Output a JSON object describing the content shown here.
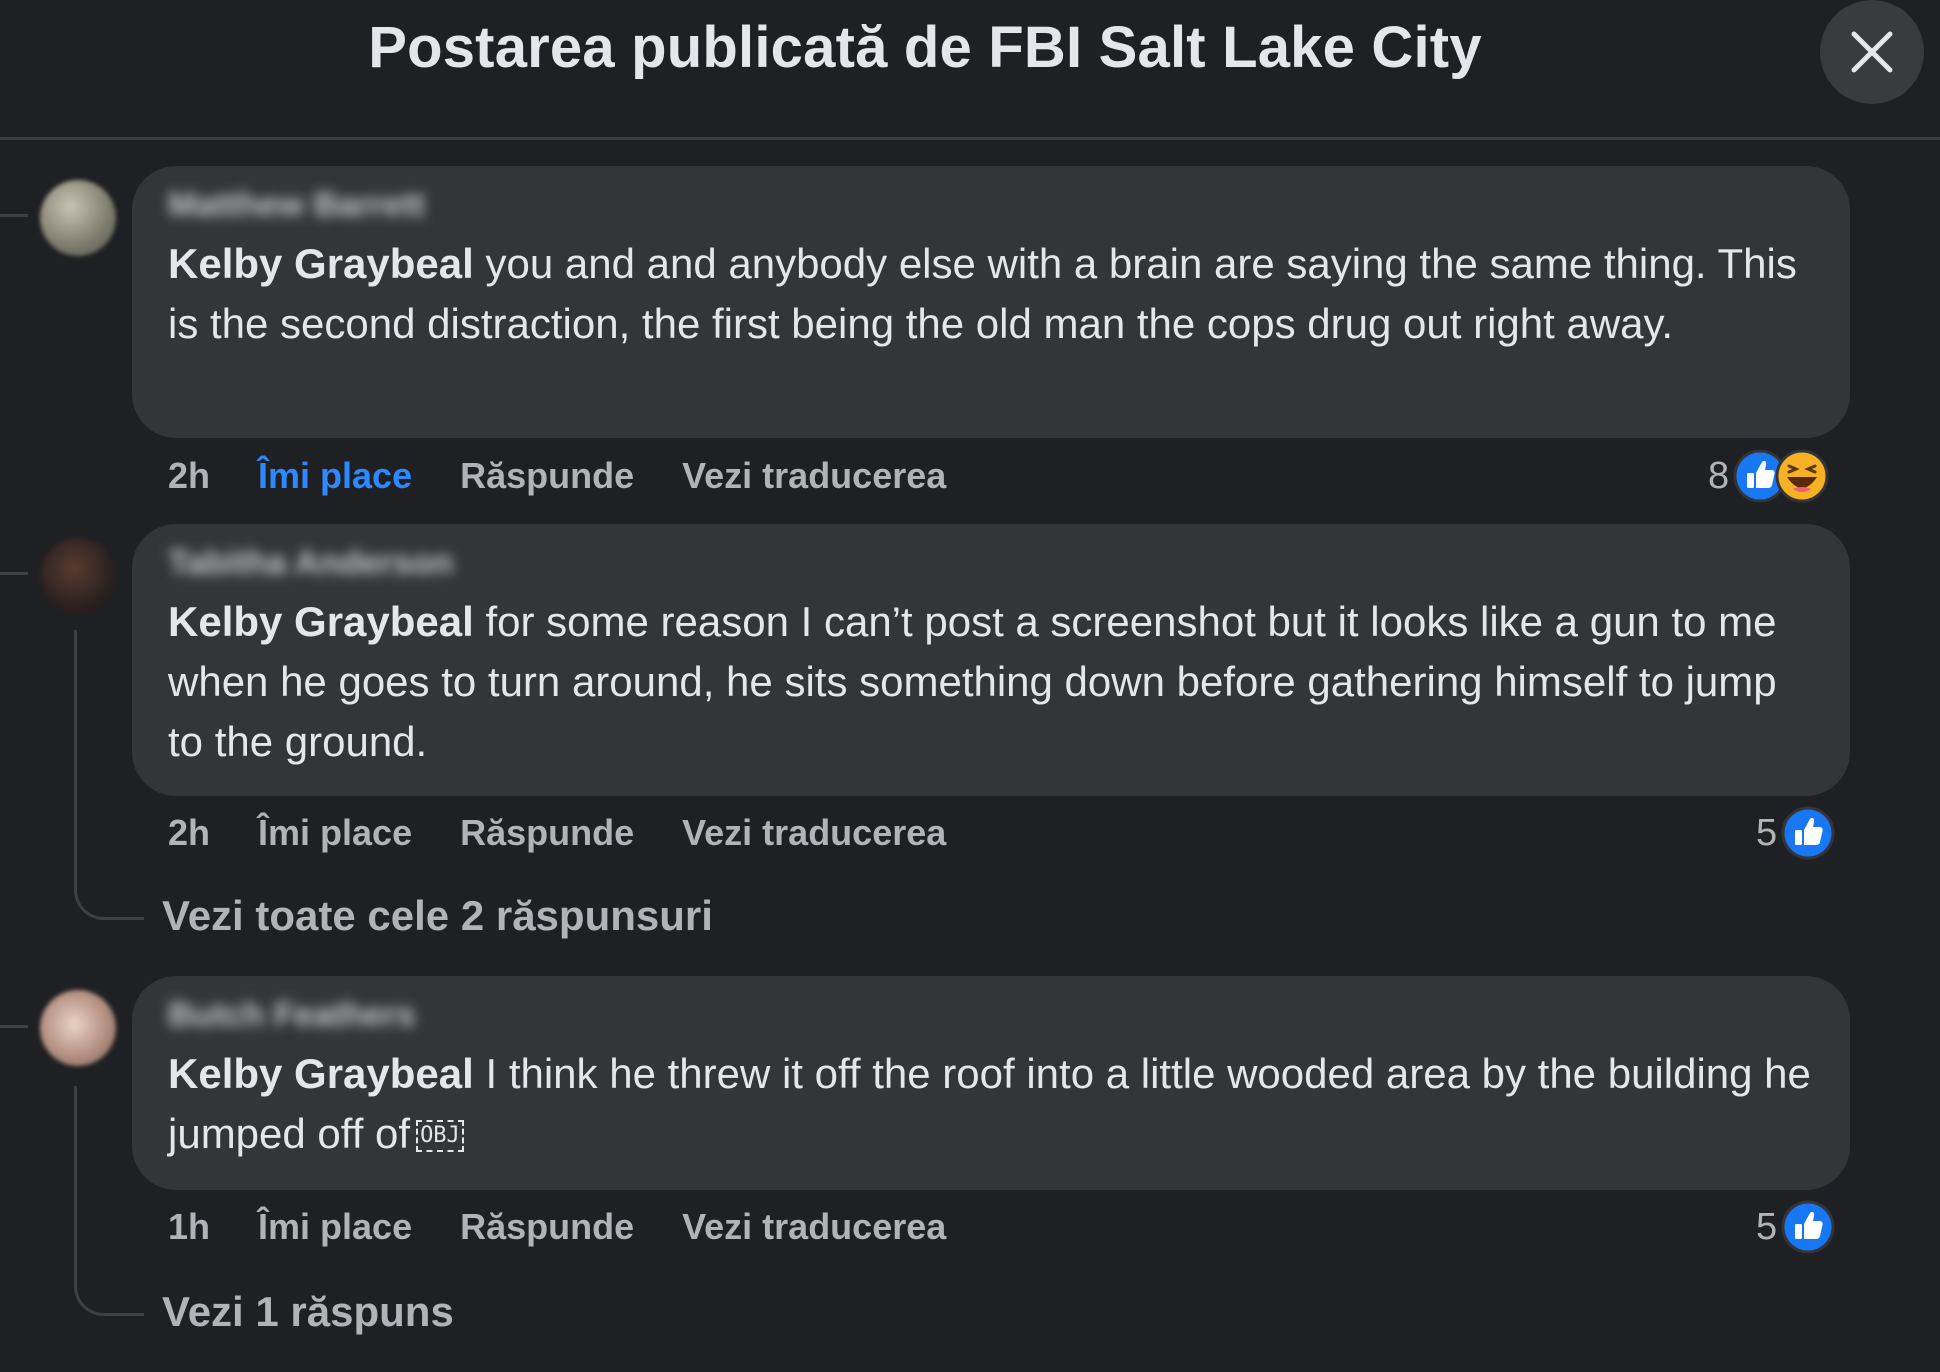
{
  "header": {
    "title": "Postarea publicată de FBI Salt Lake City"
  },
  "comments": [
    {
      "author": "Matthew Barrett",
      "mention": "Kelby Graybeal",
      "text": " you and and anybody else with a brain are saying the same thing. This is the second distraction, the first being the old man the cops drug out right away.",
      "time": "2h",
      "like_label": "Îmi place",
      "reply_label": "Răspunde",
      "translate_label": "Vezi traducerea",
      "reaction_count": "8",
      "reactions": [
        "like-icon",
        "haha-icon"
      ],
      "liked": true,
      "avatar_color": "#8f8a7e"
    },
    {
      "author": "Tabitha Anderson",
      "mention": "Kelby Graybeal",
      "text": " for some reason I can’t post a screenshot but it looks like a gun to me when he goes to turn around, he sits something down before gathering himself to jump to the ground.",
      "time": "2h",
      "like_label": "Îmi place",
      "reply_label": "Răspunde",
      "translate_label": "Vezi traducerea",
      "reaction_count": "5",
      "reactions": [
        "like-icon"
      ],
      "liked": false,
      "view_replies": "Vezi toate cele 2 răspunsuri",
      "avatar_color": "#3a2a26"
    },
    {
      "author": "Butch Feathers",
      "mention": "Kelby Graybeal",
      "text": " I think he threw it off the roof into a little wooded area by the building he jumped off of",
      "obj_glyph": "OBJ",
      "time": "1h",
      "like_label": "Îmi place",
      "reply_label": "Răspunde",
      "translate_label": "Vezi traducerea",
      "reaction_count": "5",
      "reactions": [
        "like-icon"
      ],
      "liked": false,
      "view_replies": "Vezi 1 răspuns",
      "avatar_color": "#b89a8c"
    }
  ],
  "colors": {
    "background": "#1f2023",
    "bubble": "#333538",
    "liked_blue": "#2e89ff",
    "secondary_text": "#b0b3b8"
  }
}
